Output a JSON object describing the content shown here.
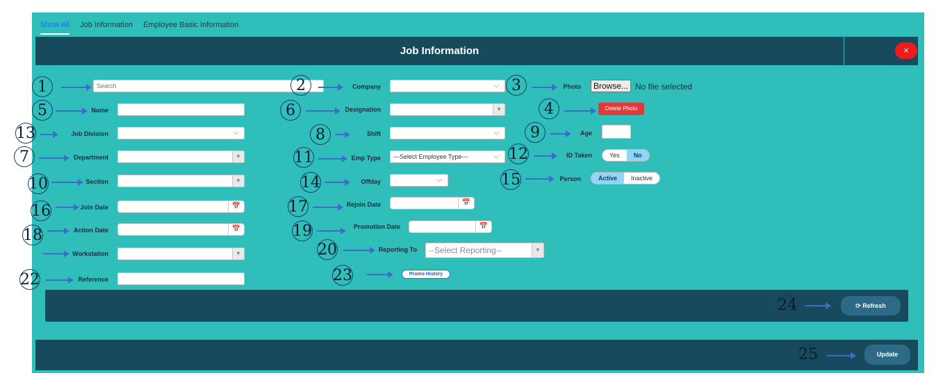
{
  "tabs": [
    {
      "label": "Show All",
      "active": true
    },
    {
      "label": "Job Information",
      "active": false
    },
    {
      "label": "Employee Basic Information",
      "active": false
    }
  ],
  "dialog": {
    "title": "Job Information",
    "close_label": "×"
  },
  "labels": {
    "company": "Company",
    "photo": "Photo",
    "name": "Name",
    "designation": "Designation",
    "job_division": "Job Division",
    "shift": "Shift",
    "age": "Age",
    "department": "Department",
    "emp_type": "Emp Type",
    "id_taken": "ID Taken",
    "section": "Section",
    "offday": "Offday",
    "person": "Person",
    "join_date": "Join Date",
    "rejoin_date": "Rejoin Date",
    "action_date": "Action Date",
    "promotion_date": "Promotion Date",
    "workstation": "Workstation",
    "reporting_to": "Reporting To",
    "reference": "Reference"
  },
  "search": {
    "placeholder": "Search"
  },
  "emp_type": {
    "selected": "---Select Employee Type---"
  },
  "reporting_to": {
    "selected": "--Select Reporting--"
  },
  "photo": {
    "browse_label": "Browse...",
    "status": "No file selected",
    "delete_label": "Delete Photo"
  },
  "id_taken": {
    "yes": "Yes",
    "no": "No",
    "selected": "No"
  },
  "person": {
    "active": "Active",
    "inactive": "Inactive",
    "selected": "Active"
  },
  "promo_history_label": "Promo History",
  "refresh_label": "Refresh",
  "update_label": "Update",
  "annotations": [
    "1",
    "2",
    "3",
    "4",
    "5",
    "6",
    "7",
    "8",
    "9",
    "10",
    "11",
    "12",
    "13",
    "14",
    "15",
    "16",
    "17",
    "18",
    "19",
    "20",
    "22",
    "23",
    "24",
    "25"
  ],
  "colors": {
    "teal": "#30bebb",
    "dark": "#184a5e",
    "accent_arrow": "#3a6ec8",
    "close_red": "#ee1c1c"
  }
}
